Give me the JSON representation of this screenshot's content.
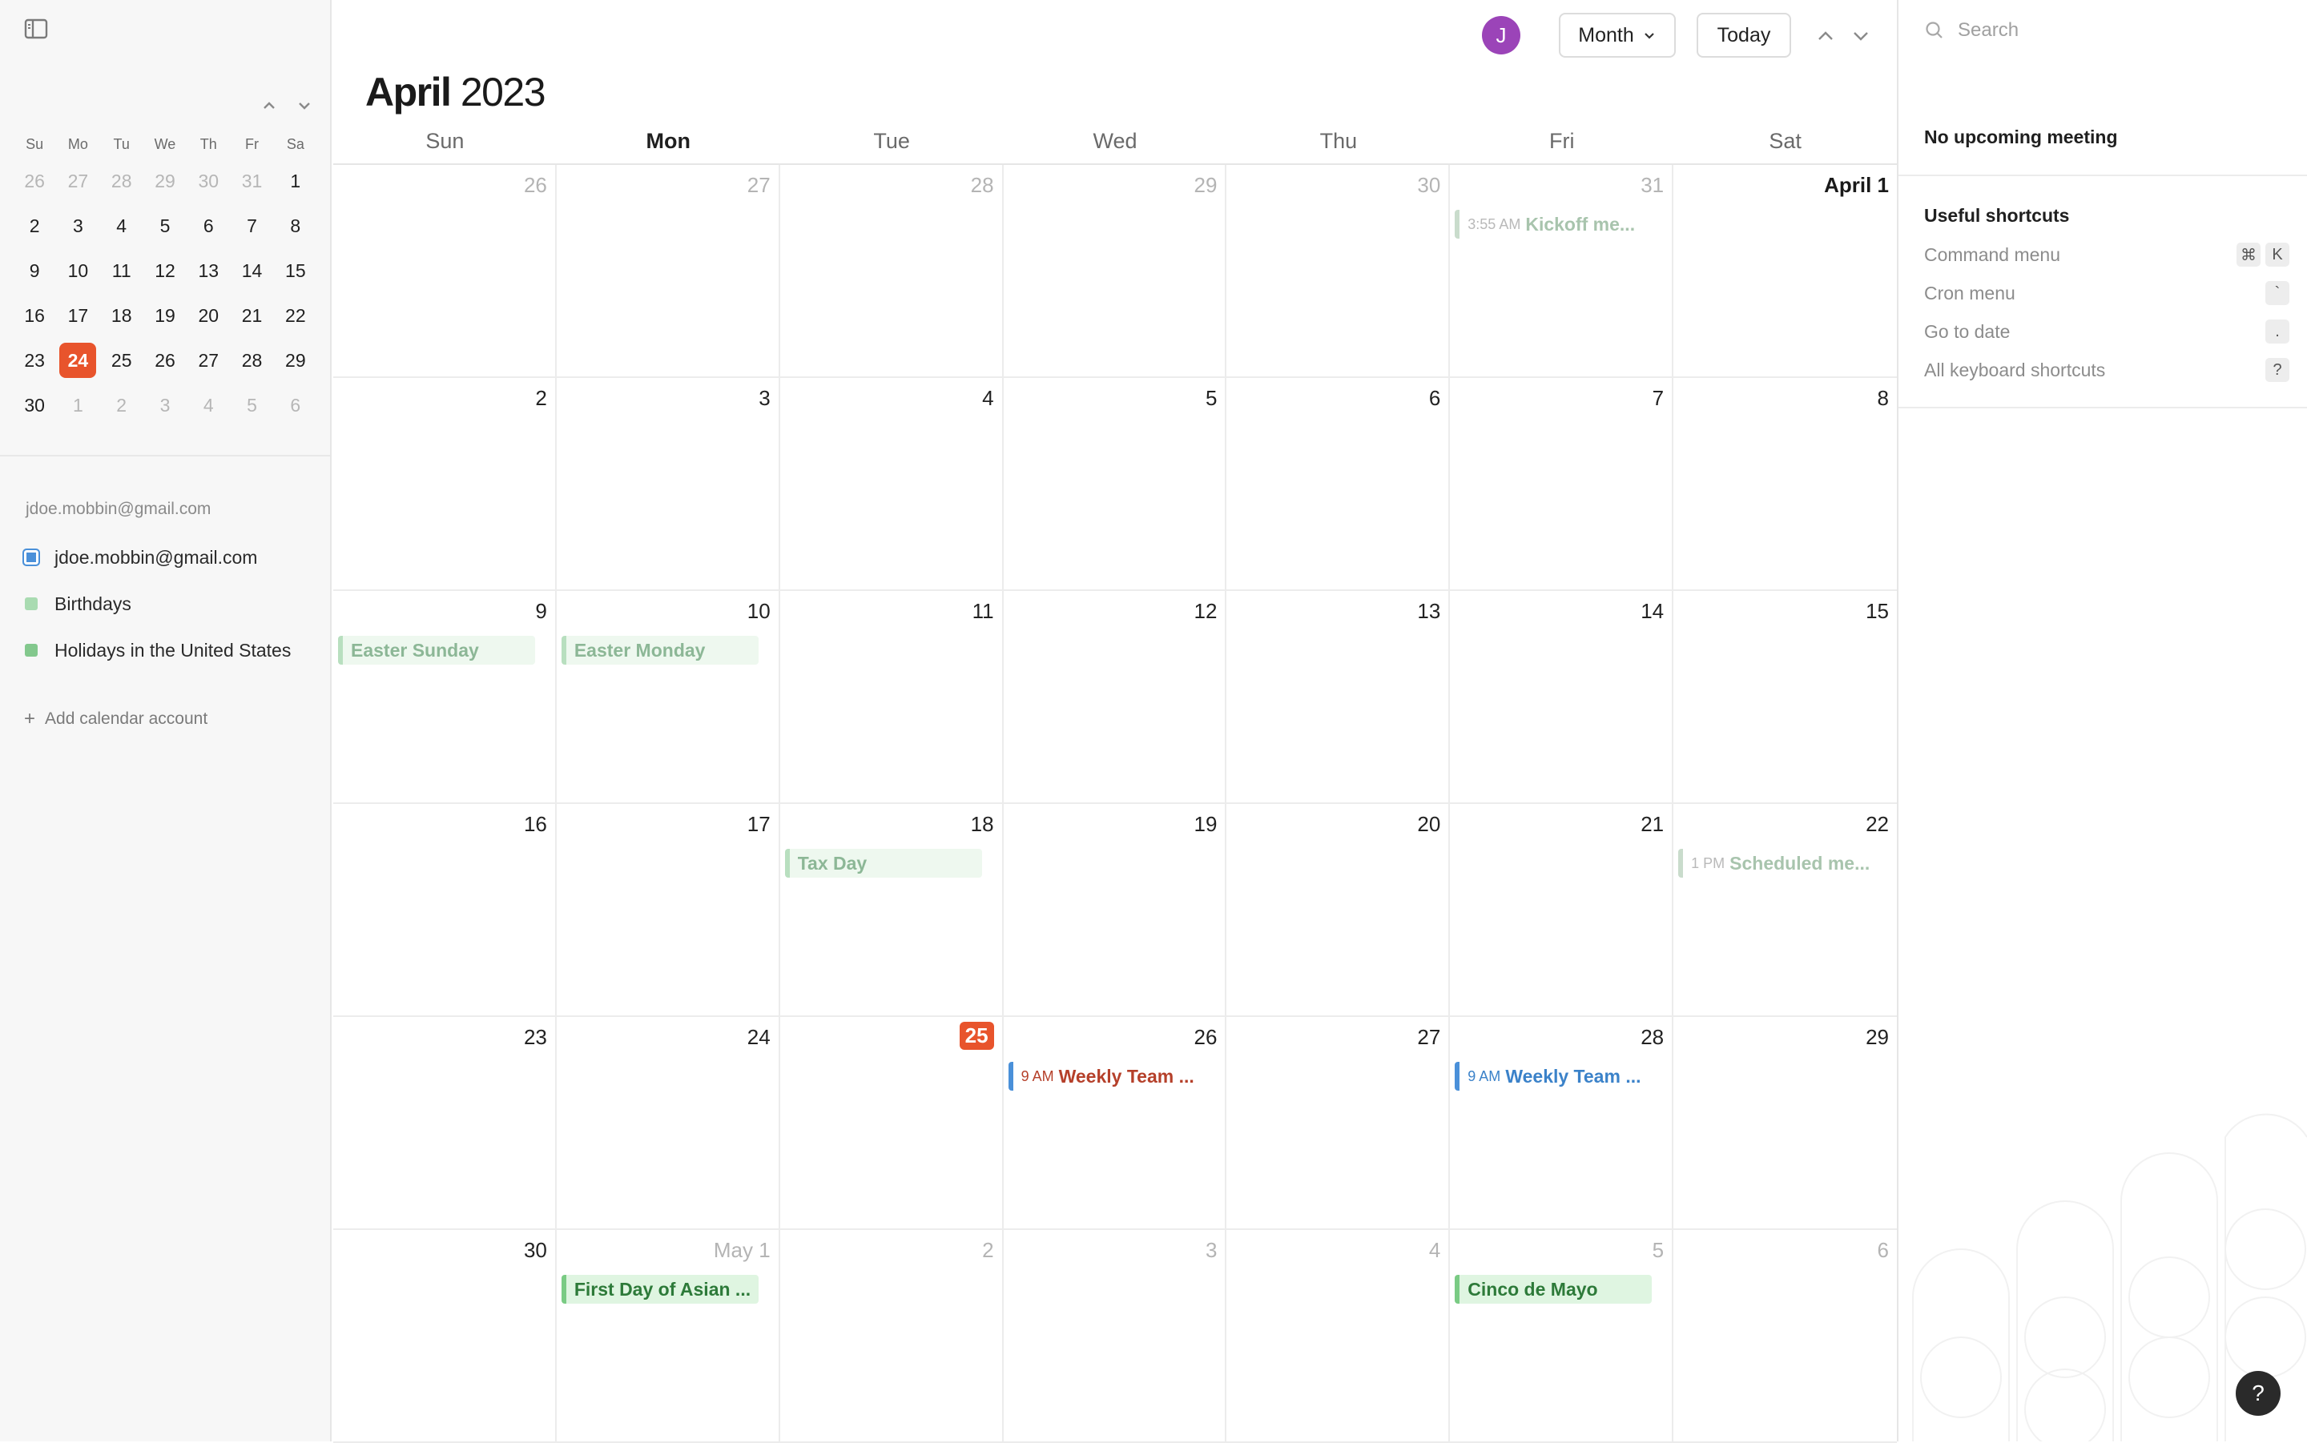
{
  "sidebar": {
    "toggle_icon": "sidebar-toggle-icon",
    "mini_calendar": {
      "weekdays": [
        "Su",
        "Mo",
        "Tu",
        "We",
        "Th",
        "Fr",
        "Sa"
      ],
      "weeks": [
        [
          {
            "d": "26",
            "m": true
          },
          {
            "d": "27",
            "m": true
          },
          {
            "d": "28",
            "m": true
          },
          {
            "d": "29",
            "m": true
          },
          {
            "d": "30",
            "m": true
          },
          {
            "d": "31",
            "m": true
          },
          {
            "d": "1"
          }
        ],
        [
          {
            "d": "2"
          },
          {
            "d": "3"
          },
          {
            "d": "4"
          },
          {
            "d": "5"
          },
          {
            "d": "6"
          },
          {
            "d": "7"
          },
          {
            "d": "8"
          }
        ],
        [
          {
            "d": "9"
          },
          {
            "d": "10"
          },
          {
            "d": "11"
          },
          {
            "d": "12"
          },
          {
            "d": "13"
          },
          {
            "d": "14"
          },
          {
            "d": "15"
          }
        ],
        [
          {
            "d": "16"
          },
          {
            "d": "17"
          },
          {
            "d": "18"
          },
          {
            "d": "19"
          },
          {
            "d": "20"
          },
          {
            "d": "21"
          },
          {
            "d": "22"
          }
        ],
        [
          {
            "d": "23"
          },
          {
            "d": "24",
            "today": true
          },
          {
            "d": "25"
          },
          {
            "d": "26"
          },
          {
            "d": "27"
          },
          {
            "d": "28"
          },
          {
            "d": "29"
          }
        ],
        [
          {
            "d": "30"
          },
          {
            "d": "1",
            "m": true
          },
          {
            "d": "2",
            "m": true
          },
          {
            "d": "3",
            "m": true
          },
          {
            "d": "4",
            "m": true
          },
          {
            "d": "5",
            "m": true
          },
          {
            "d": "6",
            "m": true
          }
        ]
      ]
    },
    "account_email": "jdoe.mobbin@gmail.com",
    "calendars": [
      {
        "label": "jdoe.mobbin@gmail.com",
        "color": "#4a90d9",
        "type": "primary"
      },
      {
        "label": "Birthdays",
        "color": "#8fd19a",
        "type": "subscribed"
      },
      {
        "label": "Holidays in the United States",
        "color": "#5cb86a",
        "type": "subscribed"
      }
    ],
    "add_calendar_label": "Add calendar account"
  },
  "toolbar": {
    "avatar_initial": "J",
    "avatar_color": "#9b44b8",
    "view_label": "Month",
    "today_label": "Today"
  },
  "calendar": {
    "month": "April",
    "year": "2023",
    "weekdays": [
      "Sun",
      "Mon",
      "Tue",
      "Wed",
      "Thu",
      "Fri",
      "Sat"
    ],
    "highlight_weekday": "Mon",
    "today_color": "#e8542c",
    "weeks": [
      [
        {
          "label": "26",
          "muted": true
        },
        {
          "label": "27",
          "muted": true
        },
        {
          "label": "28",
          "muted": true
        },
        {
          "label": "29",
          "muted": true
        },
        {
          "label": "30",
          "muted": true
        },
        {
          "label": "31",
          "muted": true,
          "events": [
            {
              "kind": "timed",
              "style": "faded",
              "time": "3:55 AM",
              "title": "Kickoff me..."
            }
          ]
        },
        {
          "label": "April 1",
          "strong": true
        }
      ],
      [
        {
          "label": "2"
        },
        {
          "label": "3"
        },
        {
          "label": "4"
        },
        {
          "label": "5"
        },
        {
          "label": "6"
        },
        {
          "label": "7"
        },
        {
          "label": "8"
        }
      ],
      [
        {
          "label": "9",
          "events": [
            {
              "kind": "allday",
              "style": "faded",
              "title": "Easter Sunday"
            }
          ]
        },
        {
          "label": "10",
          "events": [
            {
              "kind": "allday",
              "style": "faded",
              "title": "Easter Monday"
            }
          ]
        },
        {
          "label": "11"
        },
        {
          "label": "12"
        },
        {
          "label": "13"
        },
        {
          "label": "14"
        },
        {
          "label": "15"
        }
      ],
      [
        {
          "label": "16"
        },
        {
          "label": "17"
        },
        {
          "label": "18",
          "events": [
            {
              "kind": "allday",
              "style": "faded",
              "title": "Tax Day"
            }
          ]
        },
        {
          "label": "19"
        },
        {
          "label": "20"
        },
        {
          "label": "21"
        },
        {
          "label": "22",
          "events": [
            {
              "kind": "timed",
              "style": "faded",
              "time": "1 PM",
              "title": "Scheduled me..."
            }
          ]
        }
      ],
      [
        {
          "label": "23"
        },
        {
          "label": "24"
        },
        {
          "label": "25",
          "today": true
        },
        {
          "label": "26",
          "events": [
            {
              "kind": "timed",
              "style": "red",
              "time": "9 AM",
              "title": "Weekly Team ..."
            }
          ]
        },
        {
          "label": "27"
        },
        {
          "label": "28",
          "events": [
            {
              "kind": "timed",
              "style": "blue",
              "time": "9 AM",
              "title": "Weekly Team ..."
            }
          ]
        },
        {
          "label": "29"
        }
      ],
      [
        {
          "label": "30"
        },
        {
          "label": "May 1",
          "muted": true,
          "events": [
            {
              "kind": "allday",
              "style": "normal",
              "title": "First Day of Asian ..."
            }
          ]
        },
        {
          "label": "2",
          "muted": true
        },
        {
          "label": "3",
          "muted": true
        },
        {
          "label": "4",
          "muted": true
        },
        {
          "label": "5",
          "muted": true,
          "events": [
            {
              "kind": "allday",
              "style": "normal",
              "title": "Cinco de Mayo"
            }
          ]
        },
        {
          "label": "6",
          "muted": true
        }
      ]
    ]
  },
  "right_panel": {
    "search_placeholder": "Search",
    "no_upcoming": "No upcoming meeting",
    "shortcuts_title": "Useful shortcuts",
    "shortcuts": [
      {
        "label": "Command menu",
        "keys": [
          "⌘",
          "K"
        ]
      },
      {
        "label": "Cron menu",
        "keys": [
          "`"
        ]
      },
      {
        "label": "Go to date",
        "keys": [
          "."
        ]
      },
      {
        "label": "All keyboard shortcuts",
        "keys": [
          "?"
        ]
      }
    ],
    "help_label": "?"
  }
}
